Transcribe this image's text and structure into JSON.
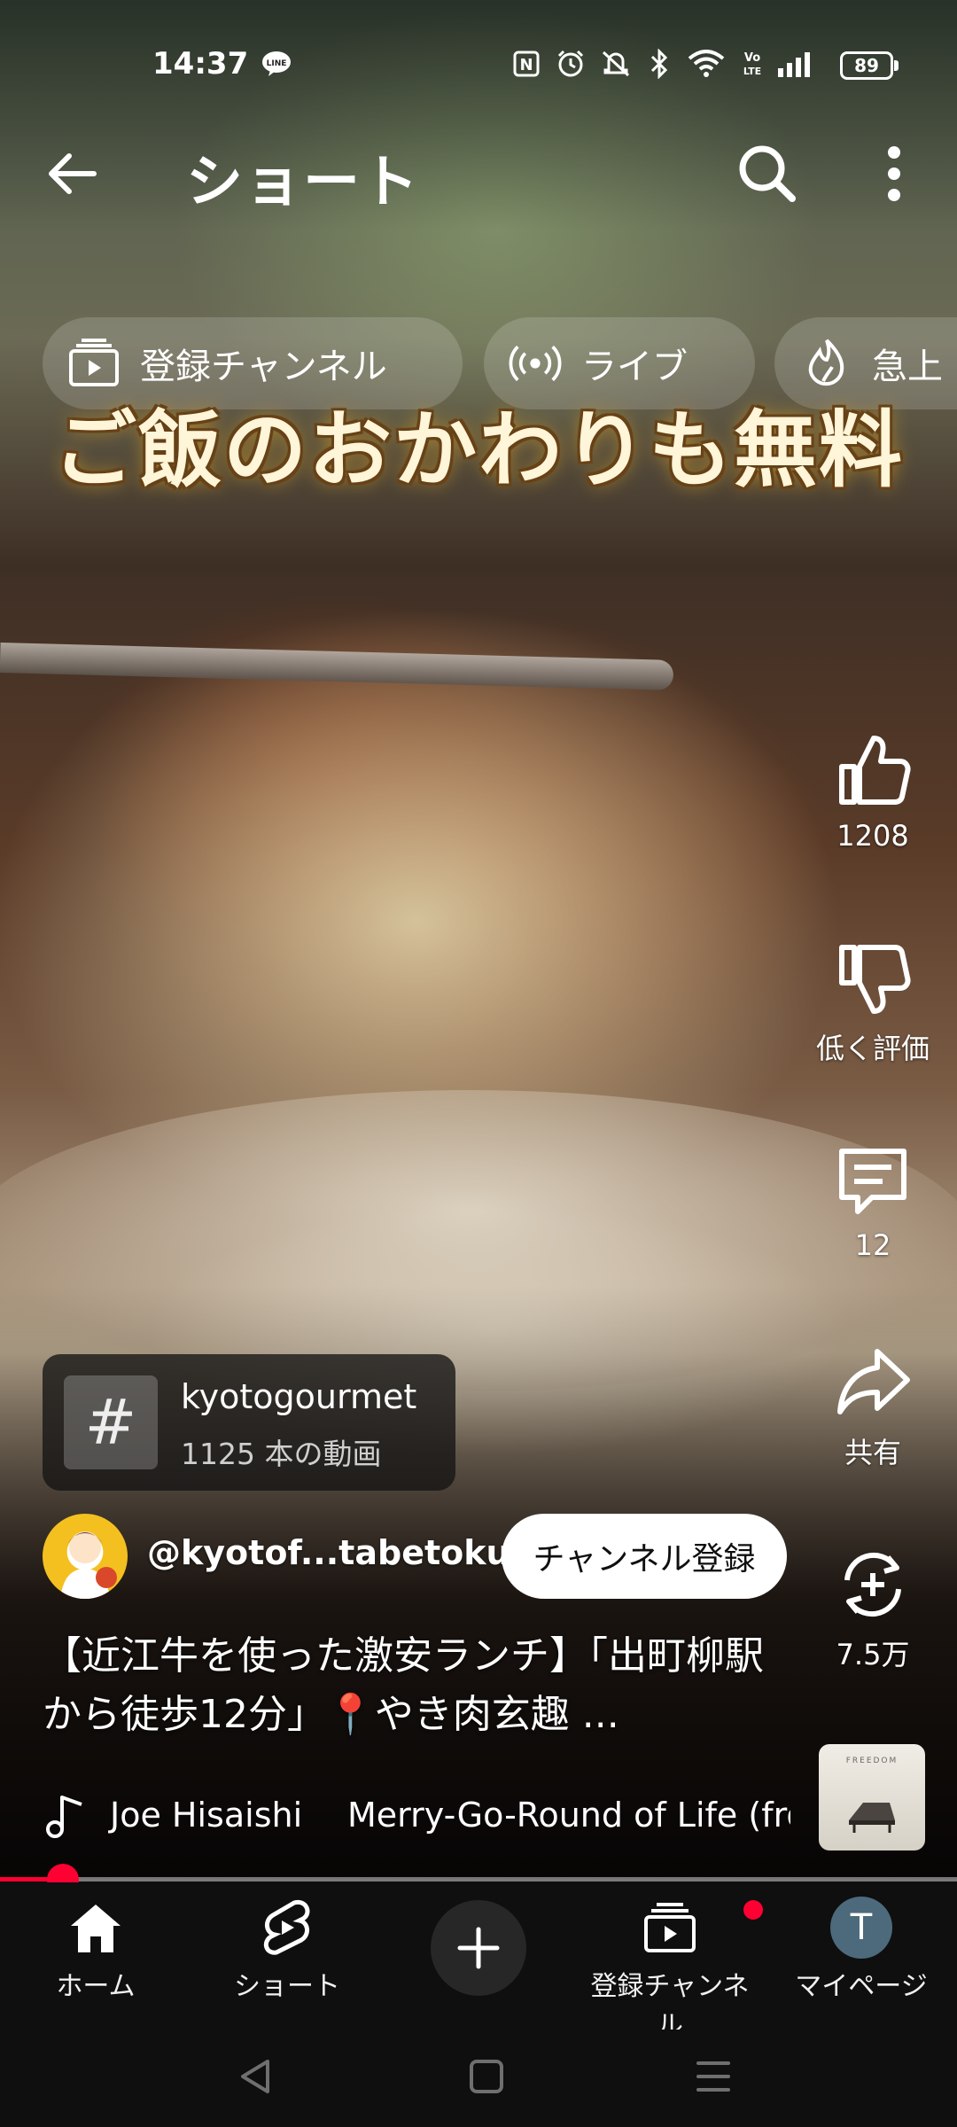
{
  "status_bar": {
    "time": "14:37",
    "battery": "89",
    "icons": [
      "line-icon",
      "nfc-icon",
      "alarm-icon",
      "mute-icon",
      "bluetooth-icon",
      "wifi-icon",
      "volte-icon",
      "signal-icon"
    ]
  },
  "header": {
    "title": "ショート"
  },
  "chips": [
    {
      "label": "登録チャンネル",
      "icon": "subscriptions-icon"
    },
    {
      "label": "ライブ",
      "icon": "live-icon"
    },
    {
      "label": "急上",
      "icon": "trending-icon"
    }
  ],
  "overlay_caption": "ご飯のおかわりも無料",
  "actions": {
    "like_count": "1208",
    "dislike_label": "低く評価",
    "comment_count": "12",
    "share_label": "共有",
    "remix_count": "7.5万"
  },
  "hashtag": {
    "symbol": "#",
    "name": "kyotogourmet",
    "count": "1125 本の動画"
  },
  "channel": {
    "handle": "@kyotof...tabetoku",
    "subscribe_label": "チャンネル登録"
  },
  "video": {
    "title": "【近江牛を使った激安ランチ】「出町柳駅から徒歩12分」📍やき肉玄趣  ...",
    "progress": 0.066
  },
  "music": {
    "artist": "Joe Hisaishi",
    "track": "Merry-Go-Round of Life (fro",
    "thumb_text": "FREEDOM"
  },
  "bottom_nav": {
    "home": "ホーム",
    "shorts": "ショート",
    "subscriptions": "登録チャンネル",
    "my_page": "マイページ",
    "avatar_letter": "T"
  },
  "colors": {
    "accent_red": "#ff0033",
    "background": "#0f0f0f"
  }
}
